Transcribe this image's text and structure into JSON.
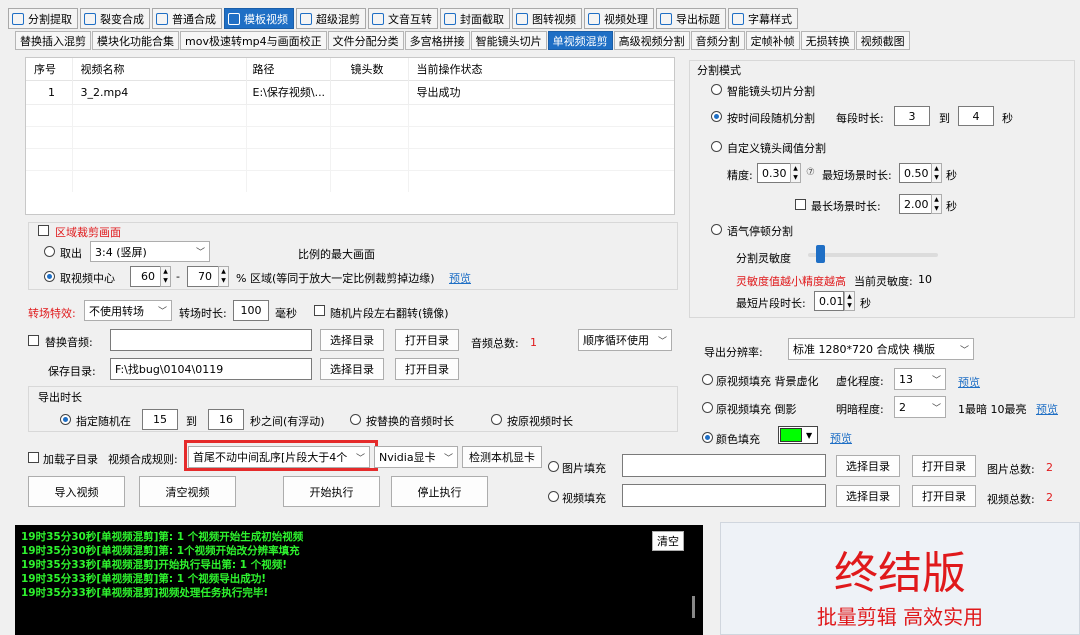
{
  "main_tabs": [
    {
      "label": "分割提取",
      "icon": "play-icon"
    },
    {
      "label": "裂变合成",
      "icon": "split-icon"
    },
    {
      "label": "普通合成",
      "icon": "arrow-icon"
    },
    {
      "label": "模板视频",
      "icon": "template-icon",
      "active": true
    },
    {
      "label": "超级混剪",
      "icon": "waveform-icon"
    },
    {
      "label": "文音互转",
      "icon": "mic-icon"
    },
    {
      "label": "封面截取",
      "icon": "image-icon"
    },
    {
      "label": "图转视频",
      "icon": "photo-icon"
    },
    {
      "label": "视频处理",
      "icon": "film-icon"
    },
    {
      "label": "导出标题",
      "icon": "export-icon"
    },
    {
      "label": "字幕样式",
      "icon": "subtitle-icon"
    }
  ],
  "sub_tabs": [
    "替换插入混剪",
    "模块化功能合集",
    "mov极速转mp4与画面校正",
    "文件分配分类",
    "多宫格拼接",
    "智能镜头切片",
    "单视频混剪",
    "高级视频分割",
    "音频分割",
    "定帧补帧",
    "无损转换",
    "视频截图"
  ],
  "active_sub_tab": "单视频混剪",
  "table": {
    "headers": [
      "序号",
      "视频名称",
      "路径",
      "镜头数",
      "当前操作状态"
    ],
    "rows": [
      [
        "1",
        "3_2.mp4",
        "E:\\保存视频\\...",
        "",
        "导出成功"
      ]
    ]
  },
  "crop": {
    "checkbox_label": "区域裁剪画面",
    "option_take": "取出",
    "ratio_value": "3:4 (竖屏)",
    "ratio_suffix": "比例的最大画面",
    "option_center": "取视频中心",
    "center_from": "60",
    "dash": "-",
    "center_to": "70",
    "center_suffix": "% 区域(等同于放大一定比例裁剪掉边缘)",
    "preview": "预览"
  },
  "transition": {
    "label": "转场特效:",
    "value": "不使用转场",
    "duration_label": "转场时长:",
    "duration": "100",
    "unit": "毫秒",
    "mirror_label": "随机片段左右翻转(镜像)"
  },
  "audio": {
    "checkbox_label": "替换音频:",
    "path": "",
    "select_dir": "选择目录",
    "open_dir": "打开目录",
    "total_label": "音频总数:",
    "total": "1",
    "order_value": "顺序循环使用"
  },
  "save": {
    "label": "保存目录:",
    "path": "F:\\找bug\\0104\\0119",
    "select_dir": "选择目录",
    "open_dir": "打开目录"
  },
  "export_duration": {
    "title": "导出时长",
    "option_random": "指定随机在",
    "from": "15",
    "to_label": "到",
    "to": "16",
    "suffix": "秒之间(有浮动)",
    "option_audio": "按替换的音频时长",
    "option_original": "按原视频时长"
  },
  "compose": {
    "sub_dir_label": "加载子目录",
    "rule_label": "视频合成规则:",
    "rule_value": "首尾不动中间乱序[片段大于4个",
    "gpu_value": "Nvidia显卡",
    "detect_gpu": "检测本机显卡"
  },
  "actions": {
    "import": "导入视频",
    "clear": "清空视频",
    "start": "开始执行",
    "stop": "停止执行"
  },
  "split_mode": {
    "title": "分割模式",
    "smart": "智能镜头切片分割",
    "by_time": "按时间段随机分割",
    "seg_label": "每段时长:",
    "seg_from": "3",
    "seg_to_label": "到",
    "seg_to": "4",
    "seg_unit": "秒",
    "custom": "自定义镜头阈值分割",
    "precision_label": "精度:",
    "precision": "0.30",
    "min_scene_label": "最短场景时长:",
    "min_scene": "0.50",
    "min_scene_unit": "秒",
    "max_scene_label": "最长场景时长:",
    "max_scene": "2.00",
    "max_scene_unit": "秒",
    "voice": "语气停顿分割",
    "sensitivity_label": "分割灵敏度",
    "sensitivity_level": 0.06,
    "sensitivity_hint": "灵敏度值越小精度越高",
    "current_label": "当前灵敏度:",
    "current": "10",
    "min_clip_label": "最短片段时长:",
    "min_clip": "0.01",
    "min_clip_unit": "秒"
  },
  "output": {
    "resolution_label": "导出分辨率:",
    "resolution_value": "标准 1280*720 合成快 横版",
    "blur_fill_label": "原视频填充 背景虚化",
    "blur_label": "虚化程度:",
    "blur_value": "13",
    "blur_preview": "预览",
    "shadow_fill_label": "原视频填充 倒影",
    "bright_label": "明暗程度:",
    "bright_value": "2",
    "bright_hint": "1最暗 10最亮",
    "bright_preview": "预览",
    "color_fill_label": "颜色填充",
    "color_value": "#00ff00",
    "color_preview": "预览",
    "image_fill": "图片填充",
    "image_path": "",
    "image_select": "选择目录",
    "image_open": "打开目录",
    "image_total_label": "图片总数:",
    "image_total": "2",
    "video_fill": "视频填充",
    "video_path": "",
    "video_select": "选择目录",
    "video_open": "打开目录",
    "video_total_label": "视频总数:",
    "video_total": "2"
  },
  "log": {
    "clear": "清空",
    "lines": [
      "19时35分30秒[单视频混剪]第: 1 个视频开始生成初始视频",
      "19时35分30秒[单视频混剪]第: 1个视频开始改分辨率填充",
      "19时35分33秒[单视频混剪]开始执行导出第: 1 个视频!",
      "19时35分33秒[单视频混剪]第: 1 个视频导出成功!",
      "19时35分33秒[单视频混剪]视频处理任务执行完毕!"
    ]
  },
  "brand": {
    "title": "终结版",
    "slogan": "批量剪辑 高效实用",
    "title_color": "#e0191b"
  }
}
